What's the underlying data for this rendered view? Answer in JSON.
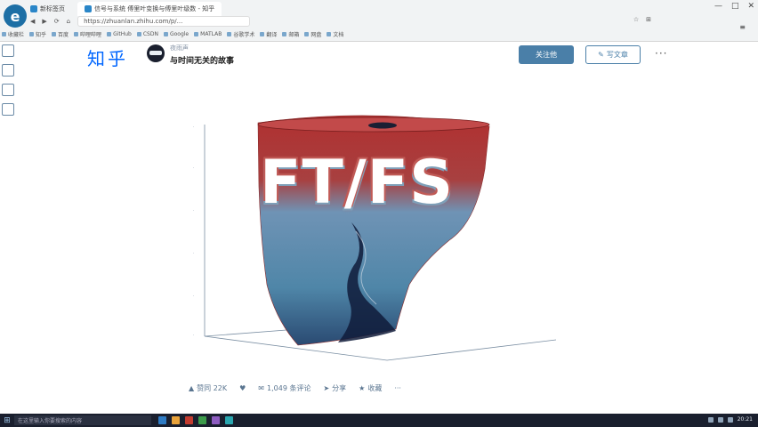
{
  "browser": {
    "tabs": [
      {
        "label": "新标签页",
        "active": false
      },
      {
        "label": "信号与系统 傅里叶变换与傅里叶级数 - 知乎",
        "active": true
      }
    ],
    "url": "https://zhuanlan.zhihu.com/p/...",
    "window_controls": [
      "—",
      "□",
      "✕"
    ],
    "bookmarks": [
      "收藏栏",
      "知乎",
      "百度",
      "哔哩哔哩",
      "GitHub",
      "CSDN",
      "Google",
      "MATLAB",
      "谷歌学术",
      "翻译",
      "邮箱",
      "网盘",
      "文档"
    ],
    "menu_icon": "menu-icon"
  },
  "header": {
    "logo": "知乎",
    "author_name": "夜雨声",
    "article_title": "与时间无关的故事",
    "follow_label": "关注他",
    "write_label": "写文章",
    "more_label": "···"
  },
  "figure": {
    "overlay_text": "FT/FS",
    "colors": {
      "top": "#b03030",
      "middle": "#4f86a8",
      "bottom": "#0f1b3a"
    }
  },
  "actions": {
    "like_label": "赞同 22K",
    "dislike_icon": "thumbs-down-icon",
    "comments_label": "1,049 条评论",
    "share_label": "分享",
    "favorite_label": "收藏",
    "more_label": "···"
  },
  "taskbar": {
    "search_placeholder": "在这里输入你要搜索的内容",
    "time": "20:21",
    "app_colors": [
      "#2e7bc4",
      "#e8a23a",
      "#c33b2f",
      "#3c9b4a",
      "#8d5cc0",
      "#2aa7b0"
    ]
  }
}
